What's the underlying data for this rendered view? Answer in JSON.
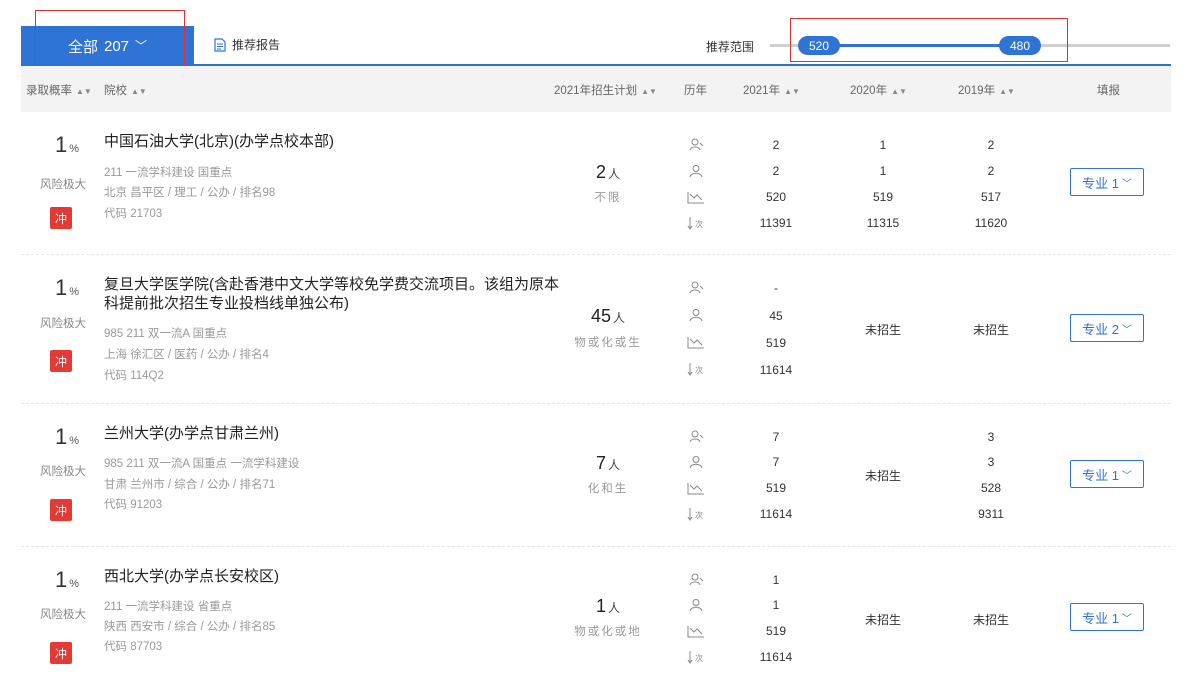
{
  "toolbar": {
    "all_label": "全部",
    "all_count": "207",
    "report_label": "推荐报告",
    "range_label": "推荐范围",
    "range_low": "520",
    "range_high": "480"
  },
  "columns": {
    "prob": "录取概率",
    "school": "院校",
    "plan": "2021年招生计划",
    "history": "历年",
    "y2021": "2021年",
    "y2020": "2020年",
    "y2019": "2019年",
    "apply": "填报"
  },
  "rows": [
    {
      "prob": "1",
      "pct": "%",
      "risk": "风险极大",
      "tag": "冲",
      "name": "中国石油大学(北京)(办学点校本部)",
      "tags": "211 一流学科建设 国重点",
      "loc": "北京 昌平区 / 理工 / 公办 / 排名98",
      "code": "代码 21703",
      "plan_num": "2",
      "plan_unit": "人",
      "plan_subj": "不限",
      "y2021": [
        "2",
        "2",
        "520",
        "11391"
      ],
      "y2020": [
        "1",
        "1",
        "519",
        "11315"
      ],
      "y2019": [
        "2",
        "2",
        "517",
        "11620"
      ],
      "y2020_note": "",
      "y2019_note": "",
      "btn": "专业 1"
    },
    {
      "prob": "1",
      "pct": "%",
      "risk": "风险极大",
      "tag": "冲",
      "name": "复旦大学医学院(含赴香港中文大学等校免学费交流项目。该组为原本科提前批次招生专业投档线单独公布)",
      "tags": "985 211 双一流A 国重点",
      "loc": "上海 徐汇区 / 医药 / 公办 / 排名4",
      "code": "代码 114Q2",
      "plan_num": "45",
      "plan_unit": "人",
      "plan_subj": "物或化或生",
      "y2021": [
        "-",
        "45",
        "519",
        "11614"
      ],
      "y2020": [],
      "y2019": [],
      "y2020_note": "未招生",
      "y2019_note": "未招生",
      "btn": "专业 2"
    },
    {
      "prob": "1",
      "pct": "%",
      "risk": "风险极大",
      "tag": "冲",
      "name": "兰州大学(办学点甘肃兰州)",
      "tags": "985 211 双一流A 国重点 一流学科建设",
      "loc": "甘肃 兰州市 / 综合 / 公办 / 排名71",
      "code": "代码 91203",
      "plan_num": "7",
      "plan_unit": "人",
      "plan_subj": "化和生",
      "y2021": [
        "7",
        "7",
        "519",
        "11614"
      ],
      "y2020": [],
      "y2019": [
        "3",
        "3",
        "528",
        "9311"
      ],
      "y2020_note": "未招生",
      "y2019_note": "",
      "btn": "专业 1"
    },
    {
      "prob": "1",
      "pct": "%",
      "risk": "风险极大",
      "tag": "冲",
      "name": "西北大学(办学点长安校区)",
      "tags": "211 一流学科建设 省重点",
      "loc": "陕西 西安市 / 综合 / 公办 / 排名85",
      "code": "代码 87703",
      "plan_num": "1",
      "plan_unit": "人",
      "plan_subj": "物或化或地",
      "y2021": [
        "1",
        "1",
        "519",
        "11614"
      ],
      "y2020": [],
      "y2019": [],
      "y2020_note": "未招生",
      "y2019_note": "未招生",
      "btn": "专业 1"
    }
  ]
}
